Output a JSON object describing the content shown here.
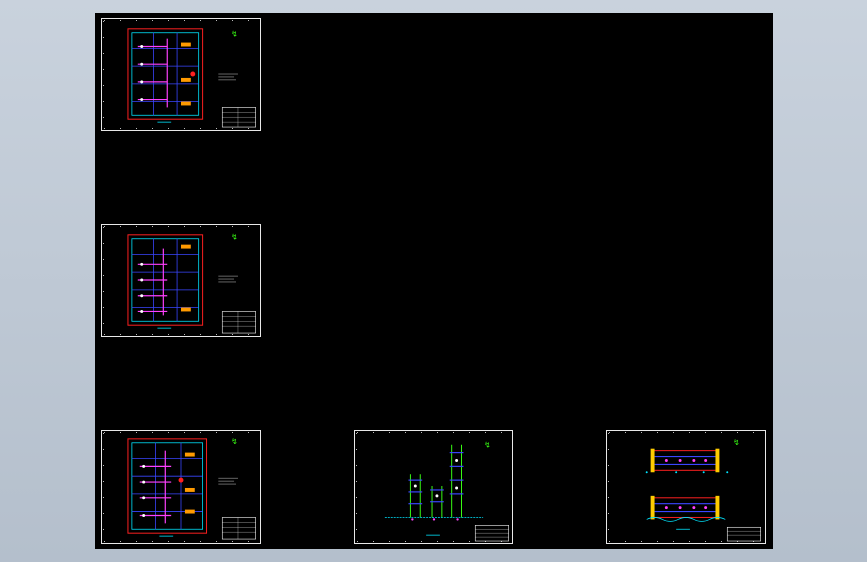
{
  "canvas": {
    "background": "#000000",
    "frame_color": "#e8e8e8"
  },
  "colors": {
    "cyan": "#00e5ff",
    "red": "#ff2020",
    "blue": "#3a46ff",
    "magenta": "#ff40ff",
    "white": "#ffffff",
    "green": "#39ff14",
    "yellow": "#ffcc00",
    "orange": "#ff9a00"
  },
  "sheets": [
    {
      "name": "plan-sheet-1",
      "kind": "plan"
    },
    {
      "name": "plan-sheet-2",
      "kind": "plan"
    },
    {
      "name": "plan-sheet-3",
      "kind": "plan"
    },
    {
      "name": "elevation-sheet",
      "kind": "elevation"
    },
    {
      "name": "section-sheet",
      "kind": "section"
    }
  ]
}
